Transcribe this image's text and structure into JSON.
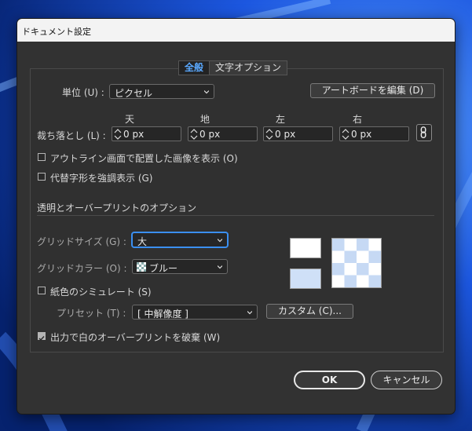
{
  "dialog": {
    "title": "ドキュメント設定"
  },
  "tabs": [
    {
      "label": "全般",
      "active": true
    },
    {
      "label": "文字オプション",
      "active": false
    }
  ],
  "units": {
    "label": "単位 (U) :",
    "value": "ピクセル"
  },
  "artboard_button": "アートボードを編集 (D)",
  "bleed": {
    "label": "裁ち落とし (L) :",
    "fields": [
      {
        "heading": "天",
        "value": "0 px"
      },
      {
        "heading": "地",
        "value": "0 px"
      },
      {
        "heading": "左",
        "value": "0 px"
      },
      {
        "heading": "右",
        "value": "0 px"
      }
    ],
    "link_icon": "link-icon"
  },
  "checkboxes": {
    "outline_images": {
      "label": "アウトライン画面で配置した画像を表示 (O)",
      "checked": false
    },
    "highlight_glyphs": {
      "label": "代替字形を強調表示 (G)",
      "checked": false
    }
  },
  "transparency": {
    "section_title": "透明とオーバープリントのオプション",
    "grid_size": {
      "label": "グリッドサイズ (G) :",
      "value": "大"
    },
    "grid_color": {
      "label": "グリッドカラー (O) :",
      "value": "ブルー"
    },
    "simulate_paper": {
      "label": "紙色のシミュレート (S)",
      "checked": false
    },
    "preset": {
      "label": "プリセット (T) :",
      "value": "[ 中解像度 ]"
    },
    "custom_button": "カスタム (C)...",
    "discard_overprint": {
      "label": "出力で白のオーバープリントを破棄 (W)",
      "checked": true
    },
    "preview_colors": {
      "paper": "#ffffff",
      "paper_tint": "#cfe0f7",
      "grid_light": "#ffffff",
      "grid_dark": "#c6d9f4"
    }
  },
  "footer": {
    "ok": "OK",
    "cancel": "キャンセル"
  },
  "colors": {
    "accent": "#5aa9ff",
    "dialog_bg": "#323232",
    "focus": "#3b8ff0"
  }
}
